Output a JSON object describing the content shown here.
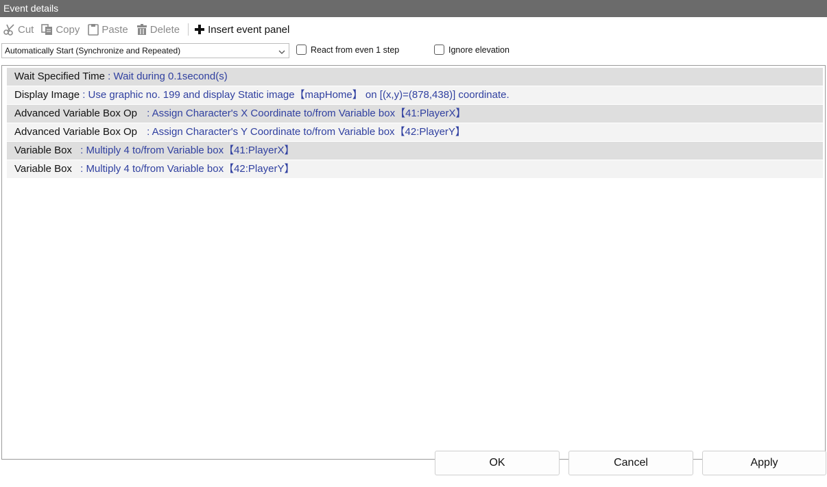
{
  "window": {
    "title": "Event details"
  },
  "toolbar": {
    "cut": "Cut",
    "copy": "Copy",
    "paste": "Paste",
    "delete": "Delete",
    "insert": "Insert event panel"
  },
  "options": {
    "trigger_selected": "Automatically Start (Synchronize and Repeated)",
    "react_label": "React from even 1 step",
    "react_checked": false,
    "ignore_label": "Ignore elevation",
    "ignore_checked": false
  },
  "events": [
    {
      "name": "Wait Specified Time",
      "desc": " : Wait during 0.1second(s)"
    },
    {
      "name": "Display Image",
      "desc": " : Use graphic no. 199 and display Static image【mapHome】 on [(x,y)=(878,438)] coordinate."
    },
    {
      "name": "Advanced Variable Box Op",
      "desc": " : Assign Character's X Coordinate to/from Variable box【41:PlayerX】"
    },
    {
      "name": "Advanced Variable Box Op",
      "desc": " : Assign Character's Y Coordinate to/from Variable box【42:PlayerY】"
    },
    {
      "name": "Variable Box",
      "desc": " : Multiply 4 to/from Variable box【41:PlayerX】"
    },
    {
      "name": "Variable Box",
      "desc": " : Multiply 4 to/from Variable box【42:PlayerY】"
    }
  ],
  "buttons": {
    "ok": "OK",
    "cancel": "Cancel",
    "apply": "Apply"
  }
}
